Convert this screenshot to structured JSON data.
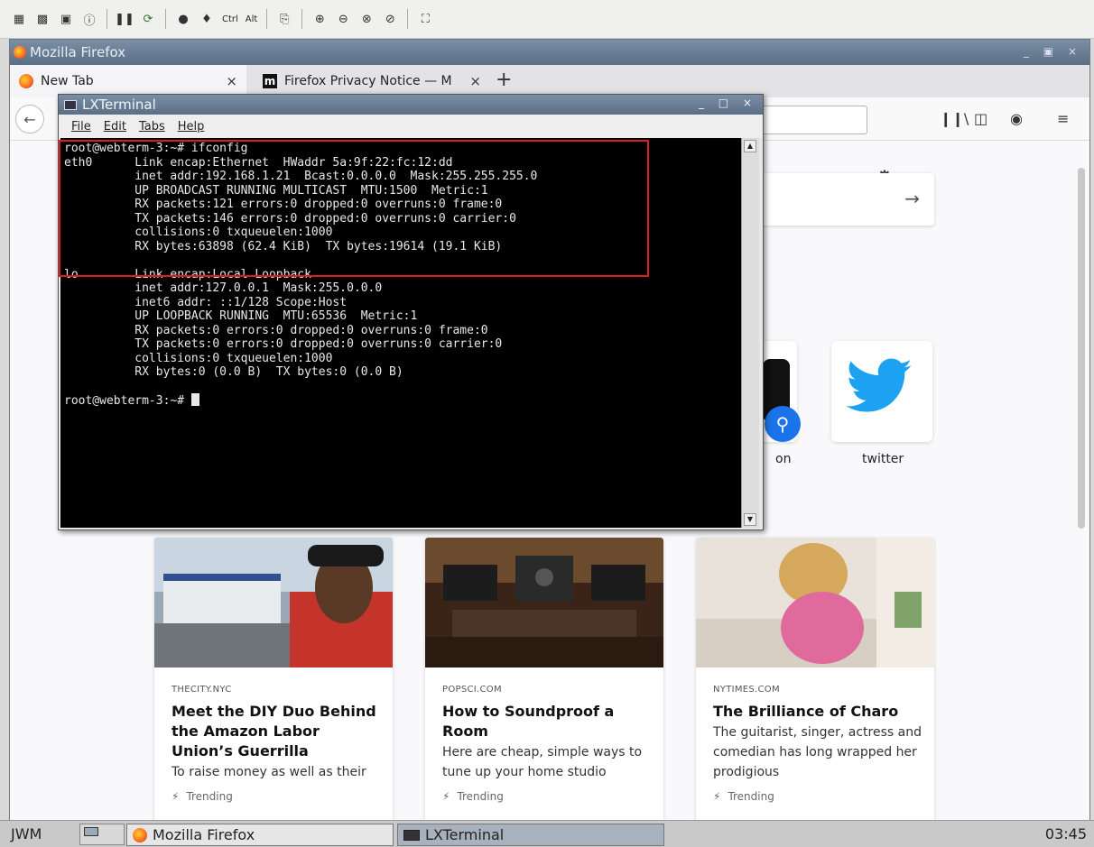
{
  "vnc_toolbar": {
    "items": [
      "send-file-icon",
      "save-icon",
      "options-icon",
      "info-icon",
      "pause-icon",
      "refresh-icon",
      "ctrl-alt-del-icon",
      "magic-key-icon",
      "ctrl-key",
      "alt-key",
      "clipboard-icon",
      "zoom-in-icon",
      "zoom-out-icon",
      "zoom-100-icon",
      "zoom-fit-icon",
      "fullscreen-icon"
    ],
    "ctrl_label": "Ctrl",
    "alt_label": "Alt"
  },
  "firefox": {
    "window_title": "Mozilla Firefox",
    "tabs": [
      {
        "label": "New Tab",
        "active": true
      },
      {
        "label": "Firefox Privacy Notice — M",
        "active": false
      }
    ],
    "top_sites": [
      {
        "label": "on"
      },
      {
        "label": "twitter"
      }
    ],
    "cards": [
      {
        "source": "THECITY.NYC",
        "title": "Meet the DIY Duo Behind the Amazon Labor Union’s Guerrilla",
        "desc": "To raise money as well as their",
        "trend": "Trending"
      },
      {
        "source": "POPSCI.COM",
        "title": "How to Soundproof a Room",
        "desc": "Here are cheap, simple ways to tune up your home studio",
        "trend": "Trending"
      },
      {
        "source": "NYTIMES.COM",
        "title": "The Brilliance of Charo",
        "desc": "The guitarist, singer, actress and comedian has long wrapped her prodigious",
        "trend": "Trending"
      }
    ]
  },
  "terminal": {
    "title": "LXTerminal",
    "menu": [
      "File",
      "Edit",
      "Tabs",
      "Help"
    ],
    "lines": [
      "root@webterm-3:~# ifconfig",
      "eth0      Link encap:Ethernet  HWaddr 5a:9f:22:fc:12:dd",
      "          inet addr:192.168.1.21  Bcast:0.0.0.0  Mask:255.255.255.0",
      "          UP BROADCAST RUNNING MULTICAST  MTU:1500  Metric:1",
      "          RX packets:121 errors:0 dropped:0 overruns:0 frame:0",
      "          TX packets:146 errors:0 dropped:0 overruns:0 carrier:0",
      "          collisions:0 txqueuelen:1000",
      "          RX bytes:63898 (62.4 KiB)  TX bytes:19614 (19.1 KiB)",
      "",
      "lo        Link encap:Local Loopback",
      "          inet addr:127.0.0.1  Mask:255.0.0.0",
      "          inet6 addr: ::1/128 Scope:Host",
      "          UP LOOPBACK RUNNING  MTU:65536  Metric:1",
      "          RX packets:0 errors:0 dropped:0 overruns:0 frame:0",
      "          TX packets:0 errors:0 dropped:0 overruns:0 carrier:0",
      "          collisions:0 txqueuelen:1000",
      "          RX bytes:0 (0.0 B)  TX bytes:0 (0.0 B)",
      "",
      "root@webterm-3:~# "
    ],
    "highlight_color": "#d92020"
  },
  "taskbar": {
    "wm_label": "JWM",
    "tasks": [
      {
        "label": "Mozilla Firefox"
      },
      {
        "label": "LXTerminal"
      }
    ],
    "clock": "03:45"
  }
}
